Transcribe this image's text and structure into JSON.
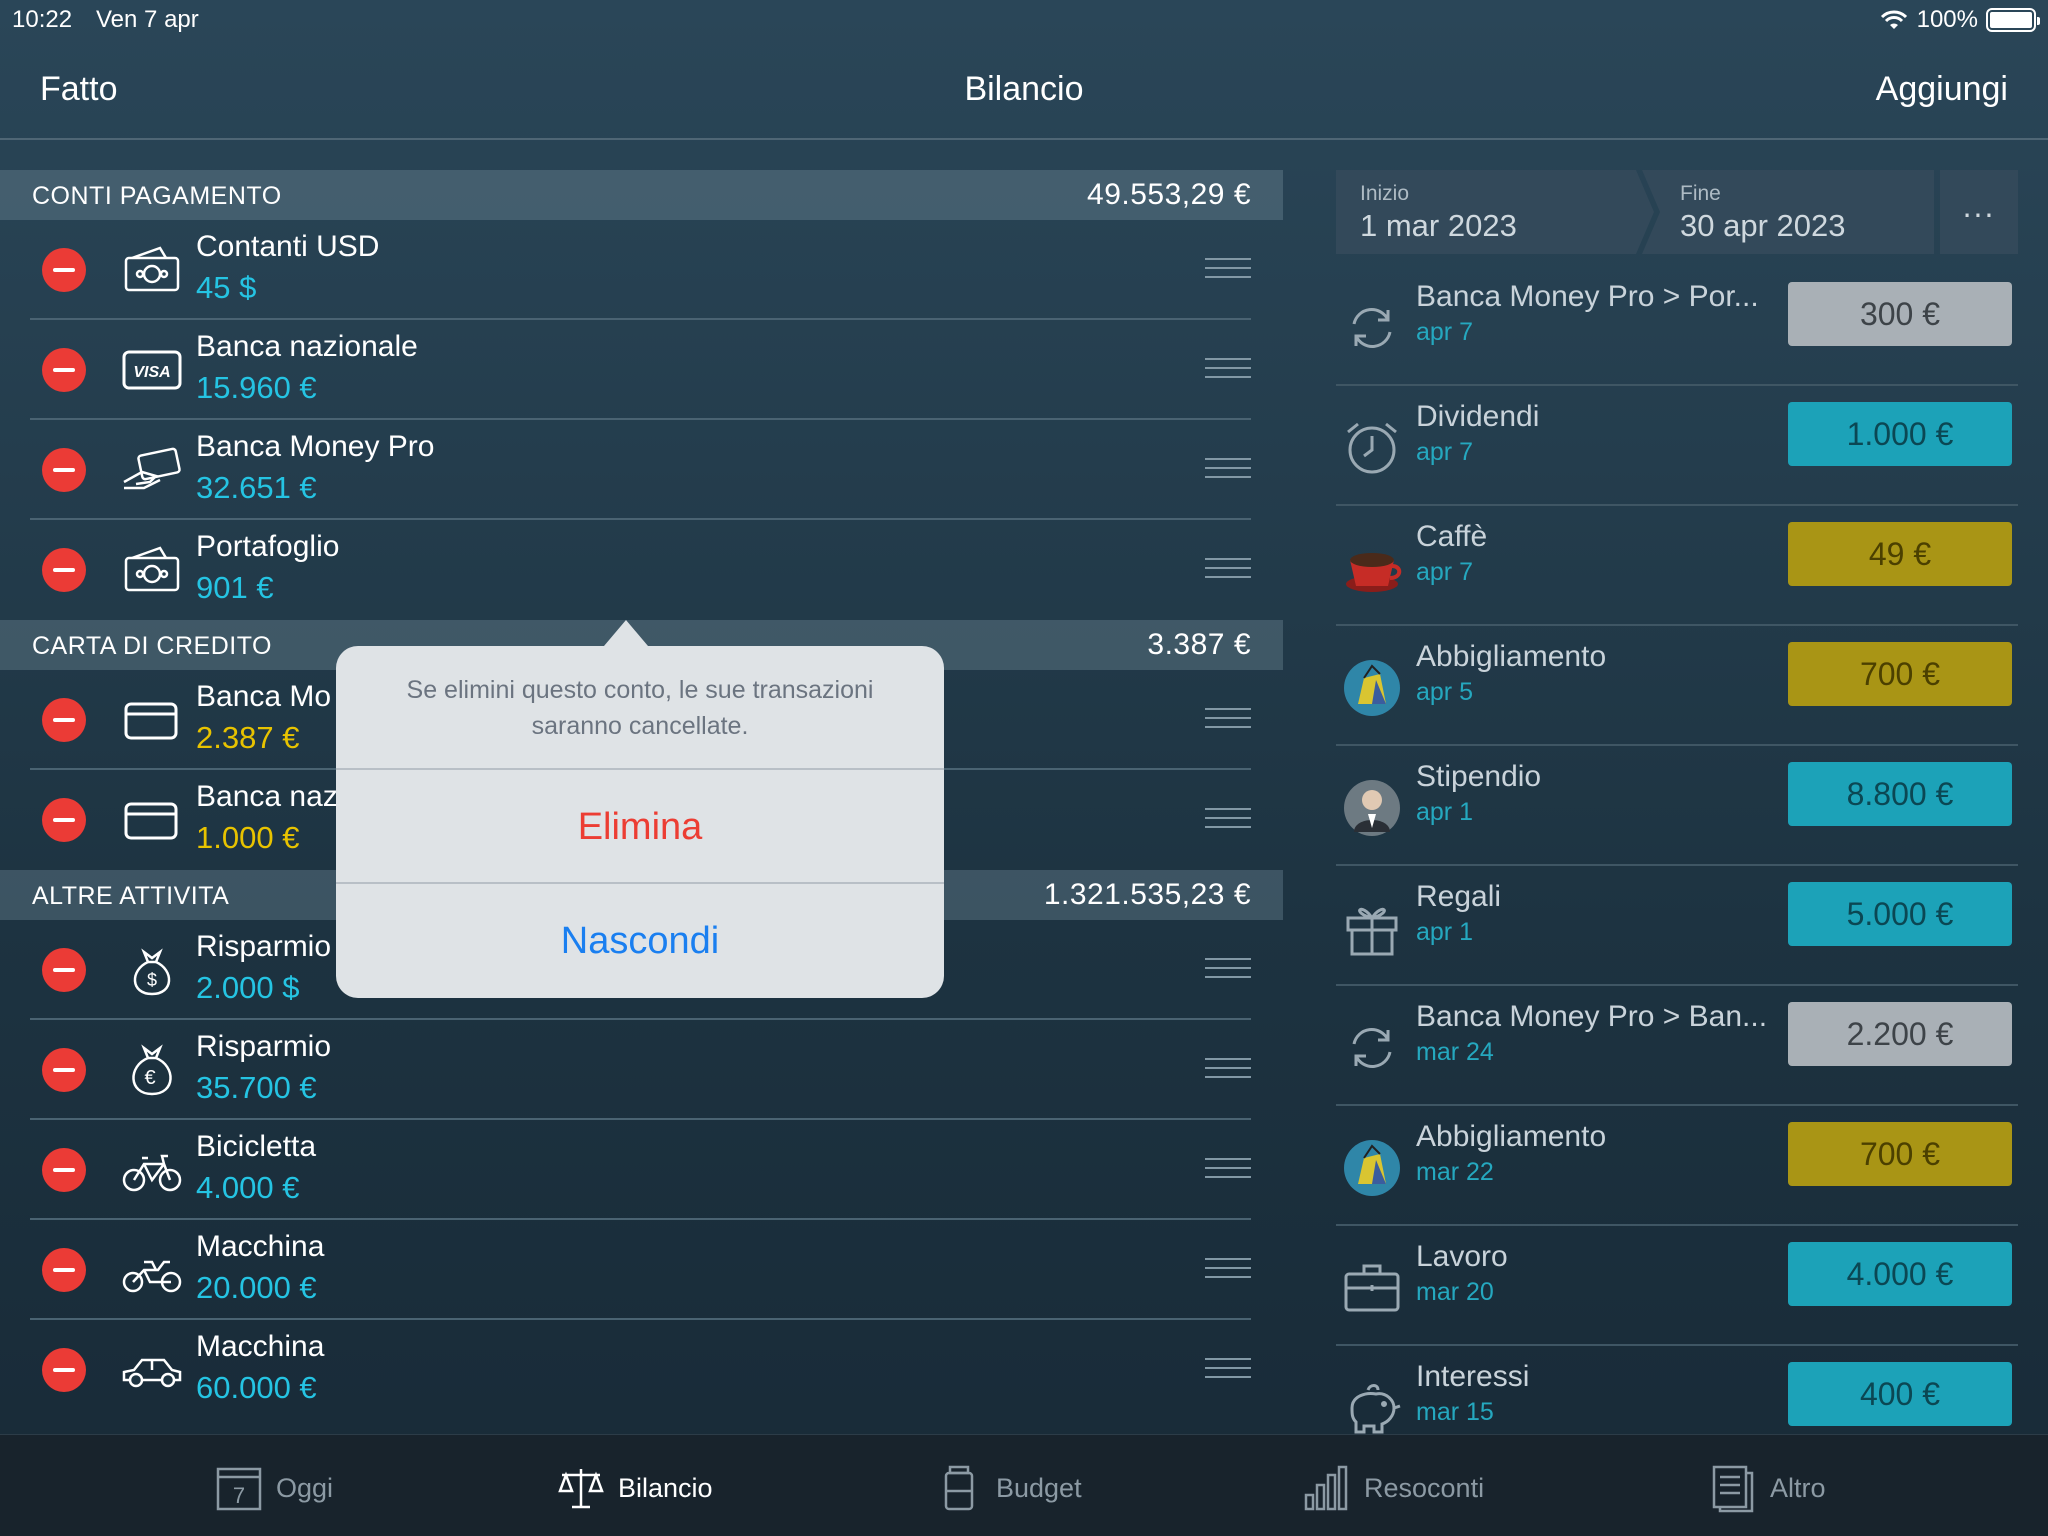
{
  "status_bar": {
    "time": "10:22",
    "date": "Ven 7 apr",
    "battery": "100%"
  },
  "nav": {
    "left": "Fatto",
    "title": "Bilancio",
    "right": "Aggiungi"
  },
  "sections": [
    {
      "title": "CONTI PAGAMENTO",
      "total": "49.553,29 €",
      "rows": [
        {
          "name": "Contanti USD",
          "value": "45 $",
          "color": "cyan",
          "icon": "cash-icon"
        },
        {
          "name": "Banca nazionale",
          "value": "15.960 €",
          "color": "cyan",
          "icon": "visa-card-icon"
        },
        {
          "name": "Banca Money Pro",
          "value": "32.651 €",
          "color": "cyan",
          "icon": "card-in-hand-icon"
        },
        {
          "name": "Portafoglio",
          "value": "901 €",
          "color": "cyan",
          "icon": "cash-icon"
        }
      ]
    },
    {
      "title": "CARTA DI CREDITO",
      "total": "3.387 €",
      "rows": [
        {
          "name": "Banca Mo",
          "value": "2.387 €",
          "color": "yellow",
          "icon": "credit-card-icon"
        },
        {
          "name": "Banca naz",
          "value": "1.000 €",
          "color": "yellow",
          "icon": "credit-card-icon"
        }
      ]
    },
    {
      "title": "ALTRE ATTIVITA",
      "total": "1.321.535,23 €",
      "rows": [
        {
          "name": "Risparmio",
          "value": "2.000 $",
          "color": "cyan",
          "icon": "money-bag-dollar-icon"
        },
        {
          "name": "Risparmio",
          "value": "35.700 €",
          "color": "cyan",
          "icon": "money-bag-euro-icon"
        },
        {
          "name": "Bicicletta",
          "value": "4.000 €",
          "color": "cyan",
          "icon": "bicycle-icon"
        },
        {
          "name": "Macchina",
          "value": "20.000 €",
          "color": "cyan",
          "icon": "motorcycle-icon"
        },
        {
          "name": "Macchina",
          "value": "60.000 €",
          "color": "cyan",
          "icon": "car-icon"
        }
      ]
    }
  ],
  "date_range": {
    "start_label": "Inizio",
    "start_value": "1 mar 2023",
    "end_label": "Fine",
    "end_value": "30 apr 2023",
    "more": "..."
  },
  "transactions": [
    {
      "name": "Banca Money Pro > Por...",
      "date": "apr 7",
      "amount": "300 €",
      "kind": "gray",
      "icon": "transfer-icon"
    },
    {
      "name": "Dividendi",
      "date": "apr 7",
      "amount": "1.000 €",
      "kind": "teal",
      "icon": "alarm-clock-icon"
    },
    {
      "name": "Caffè",
      "date": "apr 7",
      "amount": "49 €",
      "kind": "gold",
      "icon": "coffee-cup-icon"
    },
    {
      "name": "Abbigliamento",
      "date": "apr 5",
      "amount": "700 €",
      "kind": "gold",
      "icon": "shopping-bag-icon"
    },
    {
      "name": "Stipendio",
      "date": "apr 1",
      "amount": "8.800 €",
      "kind": "teal",
      "icon": "person-avatar-icon"
    },
    {
      "name": "Regali",
      "date": "apr 1",
      "amount": "5.000 €",
      "kind": "teal",
      "icon": "gift-icon"
    },
    {
      "name": "Banca Money Pro > Ban...",
      "date": "mar 24",
      "amount": "2.200 €",
      "kind": "gray",
      "icon": "transfer-icon"
    },
    {
      "name": "Abbigliamento",
      "date": "mar 22",
      "amount": "700 €",
      "kind": "gold",
      "icon": "shopping-bag-icon"
    },
    {
      "name": "Lavoro",
      "date": "mar 20",
      "amount": "4.000 €",
      "kind": "teal",
      "icon": "briefcase-icon"
    },
    {
      "name": "Interessi",
      "date": "mar 15",
      "amount": "400 €",
      "kind": "teal",
      "icon": "piggy-bank-icon"
    }
  ],
  "popover": {
    "message": "Se elimini questo conto, le sue transazioni saranno cancellate.",
    "delete": "Elimina",
    "hide": "Nascondi"
  },
  "tabs": [
    {
      "label": "Oggi",
      "icon": "calendar-icon",
      "calendar_day": "7"
    },
    {
      "label": "Bilancio",
      "icon": "scale-icon",
      "active": true
    },
    {
      "label": "Budget",
      "icon": "jar-icon"
    },
    {
      "label": "Resoconti",
      "icon": "bar-chart-icon"
    },
    {
      "label": "Altro",
      "icon": "document-icon"
    }
  ],
  "colors": {
    "delete_red": "#eb3b36",
    "cyan": "#25c4e3",
    "yellow": "#e8c300",
    "amount_gray": "#a9b0b6",
    "amount_teal": "#1ca2b8",
    "amount_gold": "#a99515",
    "link_blue": "#1a7ff0"
  }
}
